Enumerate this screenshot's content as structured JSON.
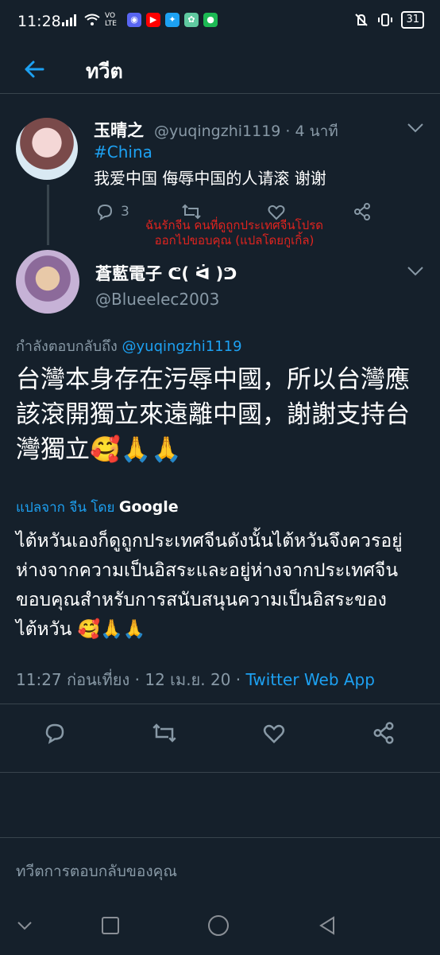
{
  "status_bar": {
    "time": "11:28",
    "network": "VO LTE",
    "battery": "31",
    "app_icons": [
      "discord-icon",
      "youtube-icon",
      "twitter-icon",
      "app-icon",
      "spotify-icon"
    ]
  },
  "header": {
    "title": "ทวีต"
  },
  "original_tweet": {
    "name": "玉晴之",
    "handle": "@yuqingzhi1119 · 4 นาที",
    "hashtag": "#China",
    "text": "我爱中国 侮辱中国的人请滚 谢谢",
    "reply_count": "3"
  },
  "overlay_annotation": {
    "line1": "ฉันรักจีน คนที่ดูถูกประเทศจีนโปรด",
    "line2": "ออกไปขอบคุณ (แปลโดยกูเกิ้ล)"
  },
  "reply_tweet": {
    "name": "蒼藍電子 ᕦ( ᐛ )ᕤ",
    "handle": "@Blueelec2003",
    "replying_prefix": "กำลังตอบกลับถึง",
    "replying_mention": "@yuqingzhi1119",
    "text": "台灣本身存在污辱中國，所以台灣應該滾開獨立來遠離中國，謝謝支持台灣獨立🥰🙏🙏",
    "translated_label": "แปลจาก จีน โดย",
    "translated_provider": "Google",
    "translation": "ไต้หวันเองก็ดูถูกประเทศจีนดังนั้นไต้หวันจึงควรอยู่ห่างจากความเป็นอิสระและอยู่ห่างจากประเทศจีนขอบคุณสำหรับการสนับสนุนความเป็นอิสระของไต้หวัน 🥰🙏🙏",
    "timestamp": "11:27 ก่อนเที่ยง · 12 เม.ย. 20 ·",
    "source_app": "Twitter Web App"
  },
  "reply_box": {
    "placeholder": "ทวีตการตอบกลับของคุณ"
  },
  "colors": {
    "background": "#15202b",
    "accent": "#1da1f2",
    "muted": "#8899a6",
    "overlay_red": "#e0241f"
  }
}
